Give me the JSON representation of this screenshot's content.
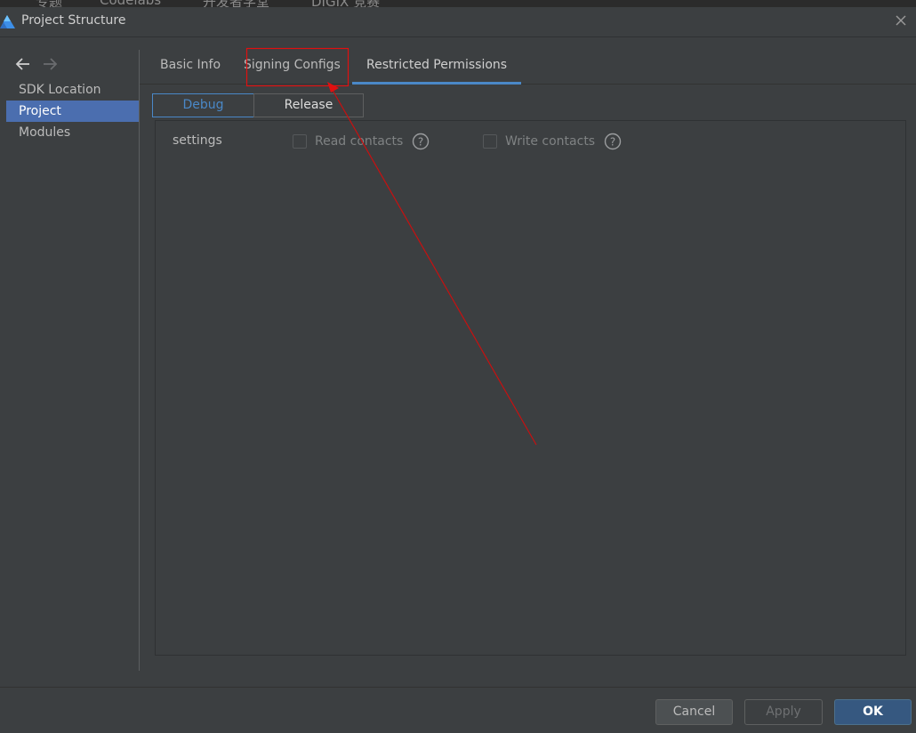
{
  "background": {
    "items": [
      "专题",
      "Codelabs",
      "开发者学堂",
      "DIGIX 竞赛"
    ]
  },
  "window": {
    "title": "Project Structure",
    "logo_icon": "app-logo-icon",
    "close_icon": "close-icon"
  },
  "sidebar": {
    "back_icon": "arrow-left-icon",
    "forward_icon": "arrow-right-icon",
    "items": [
      {
        "label": "SDK Location",
        "selected": false
      },
      {
        "label": "Project",
        "selected": true
      },
      {
        "label": "Modules",
        "selected": false
      }
    ]
  },
  "tabs": [
    {
      "label": "Basic Info",
      "active": false
    },
    {
      "label": "Signing Configs",
      "active": false
    },
    {
      "label": "Restricted Permissions",
      "active": true
    }
  ],
  "build_types": {
    "options": [
      "Debug",
      "Release"
    ],
    "selected": "Debug"
  },
  "permissions": {
    "row_label": "settings",
    "items": [
      {
        "label": "Read contacts",
        "checked": false
      },
      {
        "label": "Write contacts",
        "checked": false
      }
    ],
    "help_icon": "question-circle-icon"
  },
  "footer": {
    "cancel": "Cancel",
    "apply": "Apply",
    "ok": "OK"
  },
  "colors": {
    "accent": "#4a88c7",
    "selection": "#4b6eaf",
    "annotation": "#e01010"
  }
}
